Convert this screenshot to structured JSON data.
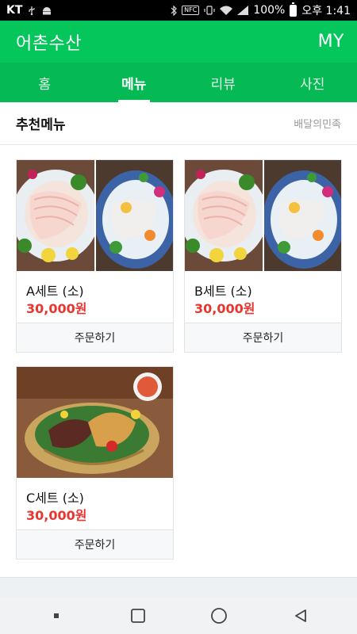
{
  "status_bar": {
    "carrier": "KT",
    "battery": "100%",
    "clock": "오후 1:41",
    "nfc": "NFC",
    "icons": [
      "usb-icon",
      "android-icon",
      "bluetooth-icon",
      "nfc-icon",
      "vibrate-icon",
      "wifi-icon",
      "signal-icon",
      "battery-icon"
    ]
  },
  "header": {
    "title": "어촌수산",
    "my_label": "MY",
    "accent": "#05c65a"
  },
  "tabs": [
    {
      "label": "홈",
      "active": false
    },
    {
      "label": "메뉴",
      "active": true
    },
    {
      "label": "리뷰",
      "active": false
    },
    {
      "label": "사진",
      "active": false
    }
  ],
  "section": {
    "title": "추천메뉴",
    "subtitle": "배달의민족"
  },
  "menu_items": [
    {
      "name": "A세트 (소)",
      "price": "30,000원",
      "order_label": "주문하기"
    },
    {
      "name": "B세트 (소)",
      "price": "30,000원",
      "order_label": "주문하기"
    },
    {
      "name": "C세트 (소)",
      "price": "30,000원",
      "order_label": "주문하기"
    }
  ],
  "price_color": "#e8352e",
  "nav_bar": {
    "icons": [
      "recents-dot-icon",
      "square-icon",
      "home-circle-icon",
      "back-triangle-icon"
    ]
  }
}
